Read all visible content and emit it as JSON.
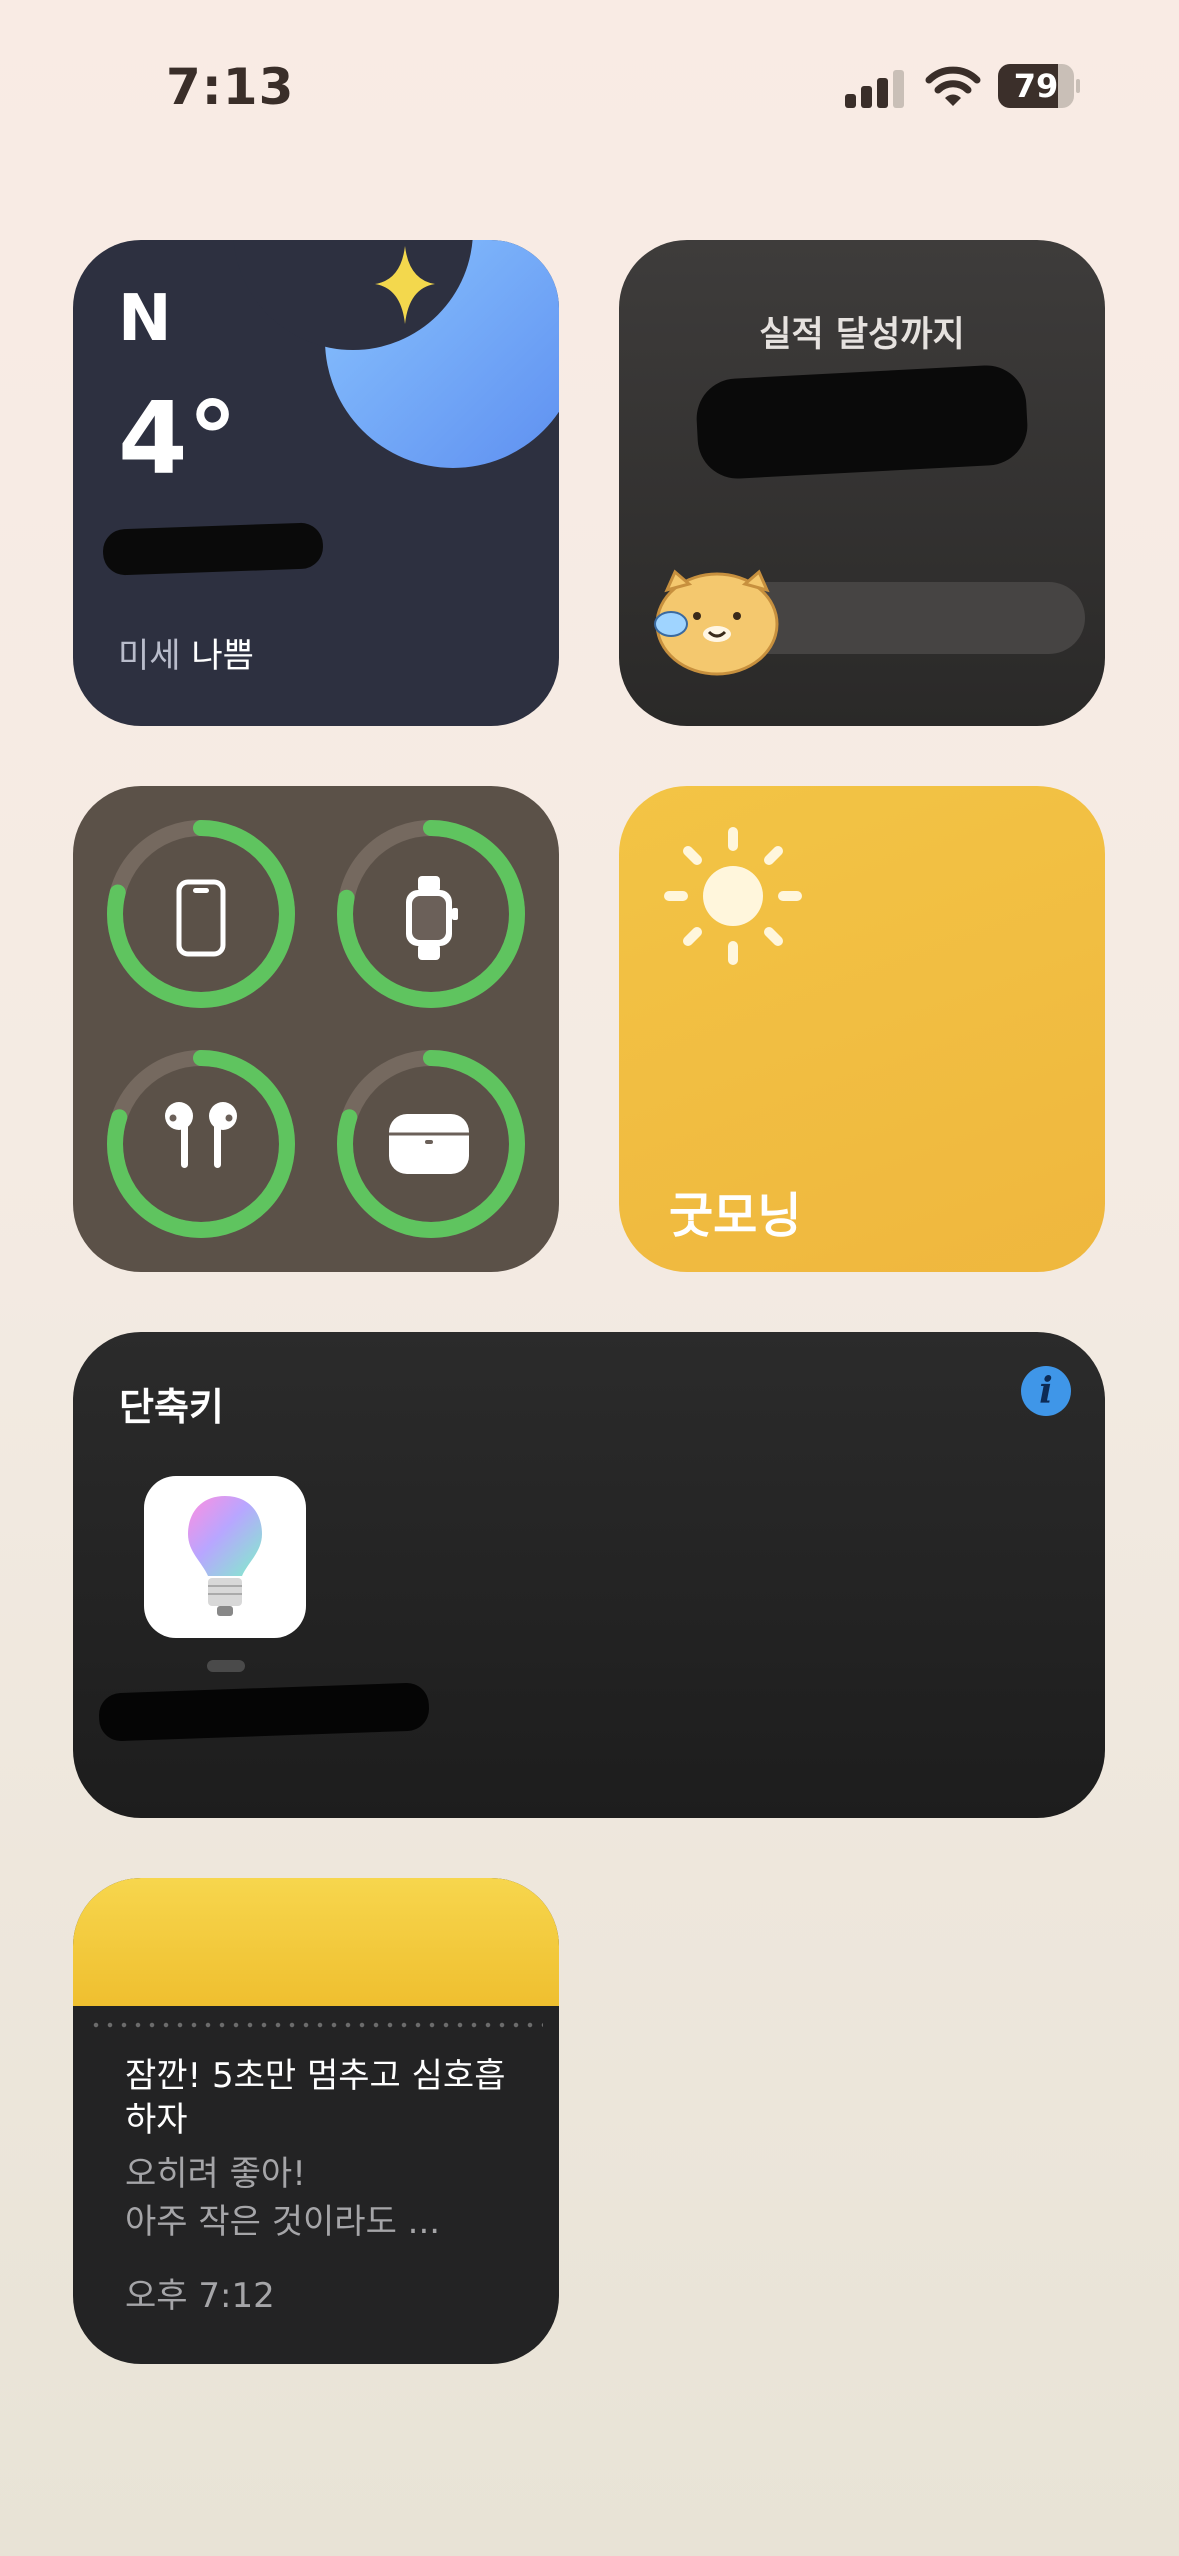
{
  "status_bar": {
    "time": "7:13",
    "battery_percent": "79",
    "battery_level": 0.79,
    "signal_icon": "cellular-signal-icon",
    "wifi_icon": "wifi-icon"
  },
  "weather_widget": {
    "brand": "N",
    "temperature": "4°",
    "dust_label": "미세",
    "dust_value": "나쁨",
    "icon": "crescent-moon-icon"
  },
  "goal_widget": {
    "title": "실적 달성까지",
    "progress": 0.0,
    "mascot_icon": "cat-mascot-icon"
  },
  "battery_widget": {
    "devices": [
      {
        "icon": "iphone-icon",
        "level": 0.79
      },
      {
        "icon": "apple-watch-icon",
        "level": 0.78
      },
      {
        "icon": "airpods-icon",
        "level": 0.8
      },
      {
        "icon": "airpods-case-icon",
        "level": 0.8
      }
    ],
    "ring_color": "#5fc45f",
    "track_color": "#75695f"
  },
  "morning_widget": {
    "label": "굿모닝",
    "icon": "sun-icon"
  },
  "shortcuts_widget": {
    "title": "단축키",
    "info_label": "i",
    "shortcut_icon": "color-light-bulb-icon"
  },
  "notes_widget": {
    "line1": "잠깐! 5초만 멈추고 심호흡 하자",
    "line2": "오히려 좋아!",
    "line3": "아주 작은 것이라도 ...",
    "time": "오후 7:12"
  },
  "colors": {
    "weather_bg": "#2d3040",
    "morning_bg": "#f0bb3f",
    "info_blue": "#3f96e8"
  }
}
